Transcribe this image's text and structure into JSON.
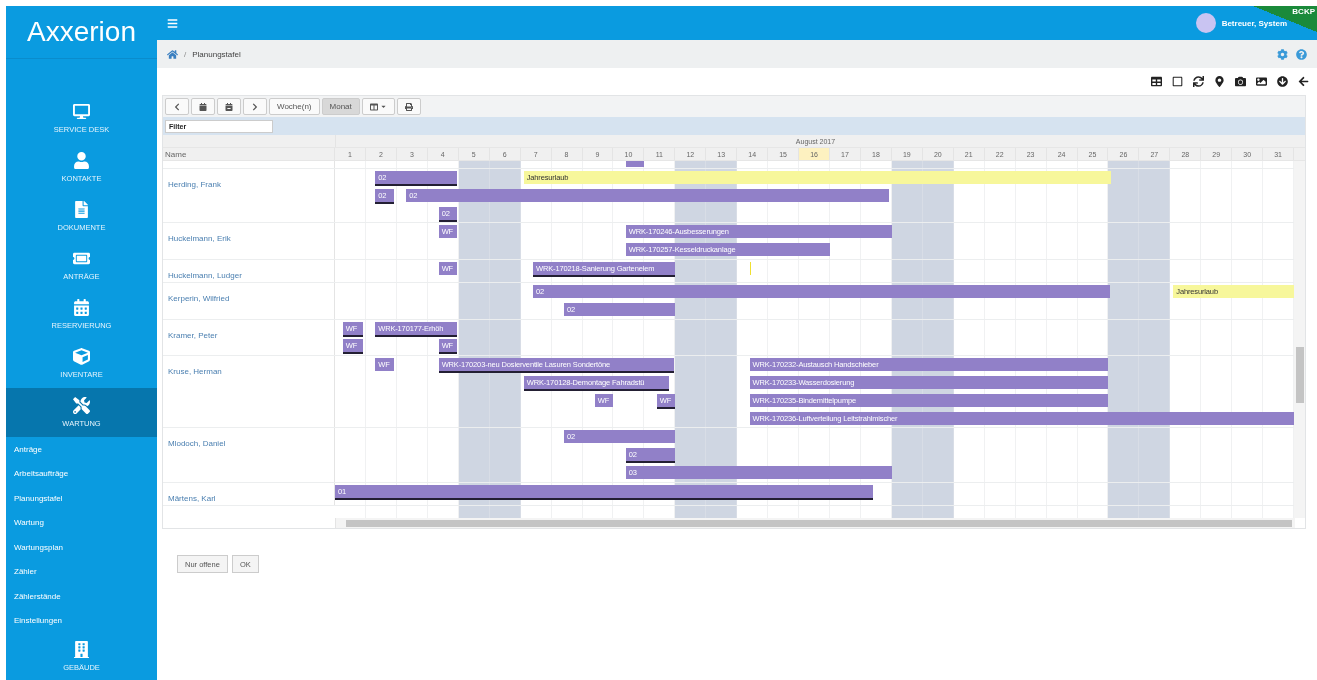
{
  "sidebar": {
    "logo": "Axxerion",
    "items": [
      {
        "label": "SERVICE DESK",
        "kind": "desk",
        "selected": false
      },
      {
        "label": "KONTAKTE",
        "kind": "contacts",
        "selected": false
      },
      {
        "label": "DOKUMENTE",
        "kind": "documents",
        "selected": false
      },
      {
        "label": "ANTRÄGE",
        "kind": "requests",
        "selected": false
      },
      {
        "label": "RESERVIERUNG",
        "kind": "booking",
        "selected": false
      },
      {
        "label": "INVENTARE",
        "kind": "inventory",
        "selected": false
      },
      {
        "label": "WARTUNG",
        "kind": "maintenance",
        "selected": true
      }
    ],
    "subitems": [
      "Anträge",
      "Arbeitsaufträge",
      "Planungstafel",
      "Wartung",
      "Wartungsplan",
      "Zähler",
      "Zählerstände",
      "Einstellungen"
    ],
    "bottom_item": {
      "label": "GEBÄUDE",
      "kind": "buildings"
    }
  },
  "topbar": {
    "user": "Betreuer, System",
    "corner_badge": "BCKP"
  },
  "breadcrumb": {
    "separator": "/",
    "current": "Planungstafel"
  },
  "planner": {
    "view_buttons": [
      {
        "label": "Woche(n)",
        "selected": false
      },
      {
        "label": "Monat",
        "selected": true
      }
    ],
    "filter": {
      "placeholder": "Filter"
    },
    "month": "August 2017",
    "name_header": "Name",
    "days": [
      {
        "label": "1",
        "weekend": false,
        "today": false
      },
      {
        "label": "2",
        "weekend": false,
        "today": false
      },
      {
        "label": "3",
        "weekend": false,
        "today": false
      },
      {
        "label": "4",
        "weekend": false,
        "today": false
      },
      {
        "label": "5",
        "weekend": true,
        "today": false
      },
      {
        "label": "6",
        "weekend": true,
        "today": false
      },
      {
        "label": "7",
        "weekend": false,
        "today": false
      },
      {
        "label": "8",
        "weekend": false,
        "today": false
      },
      {
        "label": "9",
        "weekend": false,
        "today": false
      },
      {
        "label": "10",
        "weekend": false,
        "today": false
      },
      {
        "label": "11",
        "weekend": false,
        "today": false
      },
      {
        "label": "12",
        "weekend": true,
        "today": false
      },
      {
        "label": "13",
        "weekend": true,
        "today": false
      },
      {
        "label": "14",
        "weekend": false,
        "today": false
      },
      {
        "label": "15",
        "weekend": false,
        "today": false
      },
      {
        "label": "16",
        "weekend": false,
        "today": true
      },
      {
        "label": "17",
        "weekend": false,
        "today": false
      },
      {
        "label": "18",
        "weekend": false,
        "today": false
      },
      {
        "label": "19",
        "weekend": true,
        "today": false
      },
      {
        "label": "20",
        "weekend": true,
        "today": false
      },
      {
        "label": "21",
        "weekend": false,
        "today": false
      },
      {
        "label": "22",
        "weekend": false,
        "today": false
      },
      {
        "label": "23",
        "weekend": false,
        "today": false
      },
      {
        "label": "24",
        "weekend": false,
        "today": false
      },
      {
        "label": "25",
        "weekend": false,
        "today": false
      },
      {
        "label": "26",
        "weekend": true,
        "today": false
      },
      {
        "label": "27",
        "weekend": true,
        "today": false
      },
      {
        "label": "28",
        "weekend": false,
        "today": false
      },
      {
        "label": "29",
        "weekend": false,
        "today": false
      },
      {
        "label": "30",
        "weekend": false,
        "today": false
      },
      {
        "label": "31",
        "weekend": false,
        "today": false
      }
    ],
    "rows": [
      {
        "lanes": [
          [
            {
              "kind": "task",
              "underlined": false
            }
          ]
        ]
      },
      {
        "name": "Herding, Frank",
        "lanes": [
          [
            {
              "kind": "task",
              "text": "02",
              "underlined": true
            },
            {
              "kind": "vacation",
              "text": "Jahresurlaub",
              "underlined": false
            }
          ],
          [
            {
              "kind": "task",
              "text": "02",
              "underlined": true
            },
            {
              "kind": "task",
              "text": "02",
              "underlined": false
            }
          ],
          [
            {
              "kind": "task",
              "text": "02",
              "underlined": true
            }
          ]
        ]
      },
      {
        "name": "Huckelmann, Erik",
        "lanes": [
          [
            {
              "kind": "task",
              "text": "WF",
              "underlined": false
            },
            {
              "kind": "task",
              "text": "WRK-170246-Ausbesserungen",
              "underlined": false
            }
          ],
          [
            {
              "kind": "task",
              "text": "WRK-170257-Kesseldruckanlage",
              "underlined": false
            }
          ]
        ]
      },
      {
        "name": "Huckelmann, Ludger",
        "lanes": [
          [
            {
              "kind": "task",
              "text": "WF",
              "underlined": false
            },
            {
              "kind": "task",
              "text": "WRK-170218-Sanierung Gartenelem",
              "underlined": true
            },
            {
              "kind": "marker"
            }
          ]
        ]
      },
      {
        "name": "Kerperin, Wilfried",
        "lanes": [
          [
            {
              "kind": "task",
              "text": "02",
              "underlined": false
            },
            {
              "kind": "vacation",
              "text": "Jahresurlaub",
              "underlined": false
            }
          ],
          [
            {
              "kind": "task",
              "text": "02",
              "underlined": false
            }
          ]
        ]
      },
      {
        "name": "Kramer, Peter",
        "lanes": [
          [
            {
              "kind": "task",
              "text": "WF",
              "underlined": true
            },
            {
              "kind": "task",
              "text": "WRK-170177-Erhöh",
              "underlined": true
            }
          ],
          [
            {
              "kind": "task",
              "text": "WF",
              "underlined": true
            },
            {
              "kind": "task",
              "text": "WF",
              "underlined": true
            }
          ]
        ]
      },
      {
        "name": "Kruse, Herman",
        "lanes": [
          [
            {
              "kind": "task",
              "text": "WF",
              "underlined": false
            },
            {
              "kind": "task",
              "text": "WRK-170203-neu Dosierventile Lasuren Sondertöne",
              "underlined": true
            },
            {
              "kind": "task",
              "text": "WRK-170232-Austausch Handschieber",
              "underlined": false
            }
          ],
          [
            {
              "kind": "task",
              "text": "WRK-170128-Demontage Fahradstü",
              "underlined": true
            },
            {
              "kind": "task",
              "text": "WRK-170233-Wasserdosierung",
              "underlined": false
            }
          ],
          [
            {
              "kind": "task",
              "text": "WF",
              "underlined": false
            },
            {
              "kind": "task",
              "text": "WF",
              "underlined": true
            },
            {
              "kind": "task",
              "text": "WRK-170235-Bindemittelpumpe",
              "underlined": false
            }
          ],
          [
            {
              "kind": "task",
              "text": "WRK-170236-Luftverteilung Leitstrahlmischer",
              "underlined": false
            }
          ]
        ]
      },
      {
        "name": "Mlodoch, Daniel",
        "lanes": [
          [
            {
              "kind": "task",
              "text": "02",
              "underlined": false
            }
          ],
          [
            {
              "kind": "task",
              "text": "02",
              "underlined": true
            }
          ],
          [
            {
              "kind": "task",
              "text": "03",
              "underlined": false
            }
          ]
        ]
      },
      {
        "name": "Märtens, Karl",
        "lanes": [
          [
            {
              "kind": "task",
              "text": "01",
              "underlined": true
            }
          ]
        ]
      }
    ]
  },
  "footer_buttons": [
    "Nur offene",
    "OK"
  ]
}
